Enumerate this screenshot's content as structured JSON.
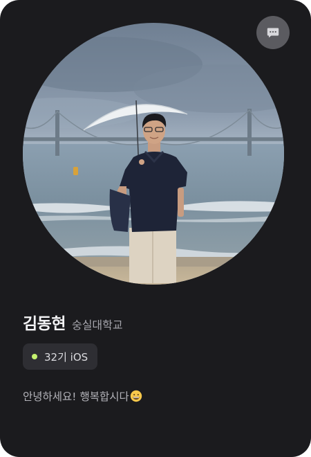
{
  "profile": {
    "name": "김동현",
    "school": "숭실대학교",
    "badge": "32기 iOS",
    "bio": "안녕하세요! 행복합시다"
  },
  "icons": {
    "chat": "chat-bubble-icon",
    "emoji": "grinning-face-emoji"
  },
  "colors": {
    "card_background": "#1b1b1e",
    "badge_background": "#2e2e33",
    "badge_dot": "#c5f26f",
    "chat_button": "#5b5b60"
  }
}
